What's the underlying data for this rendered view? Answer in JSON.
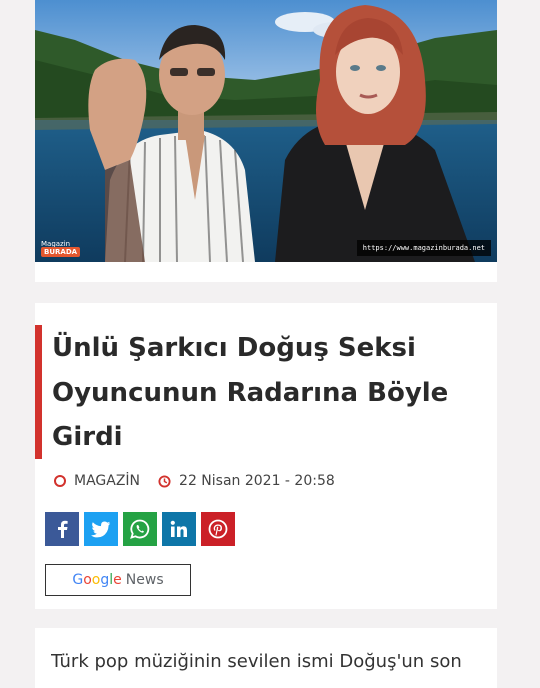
{
  "hero": {
    "image_alt": "Doğuş ve oyuncu, göl ve orman manzarası önünde",
    "watermark_url": "https://www.magazinburada.net",
    "logo_line1": "Magazin",
    "logo_line2": "BURADA"
  },
  "article": {
    "title": "Ünlü Şarkıcı Doğuş Seksi Oyuncunun Radarına Böyle Girdi",
    "category": "MAGAZİN",
    "date": "22 Nisan 2021 - 20:58",
    "accent_color": "#d2322d"
  },
  "share": [
    {
      "icon": "facebook-icon",
      "color": "#3b5998"
    },
    {
      "icon": "twitter-icon",
      "color": "#1da1f2"
    },
    {
      "icon": "whatsapp-icon",
      "color": "#25a244"
    },
    {
      "icon": "linkedin-icon",
      "color": "#0e76a8"
    },
    {
      "icon": "pinterest-icon",
      "color": "#cb2027"
    }
  ],
  "google_news": {
    "logo_letters": [
      "G",
      "o",
      "o",
      "g",
      "l",
      "e"
    ],
    "logo_colors": [
      "#4285f4",
      "#ea4335",
      "#fbbc05",
      "#4285f4",
      "#34a853",
      "#ea4335"
    ],
    "label": "News"
  },
  "body": {
    "first_line": "Türk pop müziğinin sevilen ismi Doğuş'un son"
  }
}
